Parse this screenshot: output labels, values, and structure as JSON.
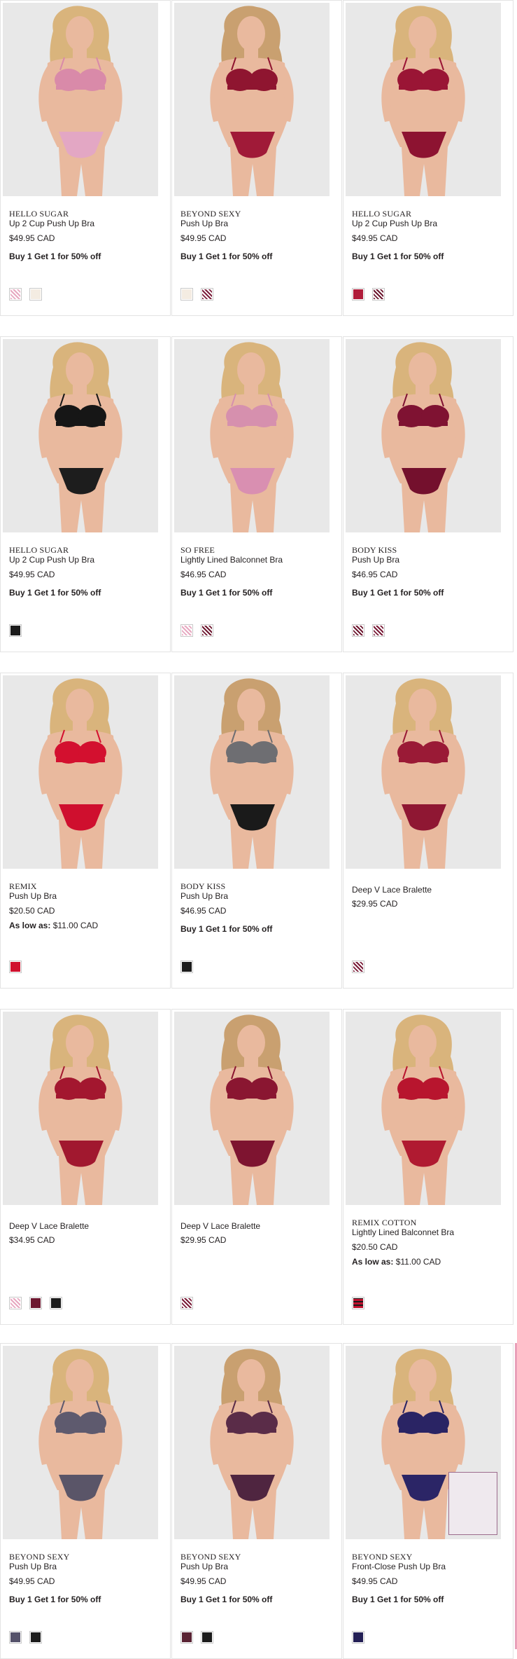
{
  "accent_colors": {
    "photo_background": "#e8e8e8",
    "card_border": "#e3e3e3",
    "text": "#231f20",
    "edge_highlight": "#e9a0b9"
  },
  "products": [
    {
      "brand": "HELLO SUGAR",
      "name": "Up 2 Cup Push Up Bra",
      "price": "$49.95 CAD",
      "promo": "Buy 1 Get 1 for 50% off",
      "swatches": [
        {
          "name": "pink-lace-swatch",
          "color": "#e7a8c0",
          "pattern": "lace"
        },
        {
          "name": "ivory-swatch",
          "color": "#f4ece2",
          "pattern": "solid"
        }
      ],
      "model": {
        "bra": "#d98aa9",
        "panty": "#e3a7c4",
        "skin": "#e9b99e",
        "hair": "#d9b47c"
      }
    },
    {
      "brand": "BEYOND SEXY",
      "name": "Push Up Bra",
      "price": "$49.95 CAD",
      "promo": "Buy 1 Get 1 for 50% off",
      "swatches": [
        {
          "name": "ivory-swatch",
          "color": "#f4ece2",
          "pattern": "solid"
        },
        {
          "name": "wine-swatch",
          "color": "#7c1f3c",
          "pattern": "lace"
        }
      ],
      "model": {
        "bra": "#8f1530",
        "panty": "#a01a38",
        "skin": "#e9b99e",
        "hair": "#c9a070"
      }
    },
    {
      "brand": "HELLO SUGAR",
      "name": "Up 2 Cup Push Up Bra",
      "price": "$49.95 CAD",
      "promo": "Buy 1 Get 1 for 50% off",
      "swatches": [
        {
          "name": "red-swatch",
          "color": "#b01c3a",
          "pattern": "solid"
        },
        {
          "name": "wine-swatch",
          "color": "#6d1830",
          "pattern": "lace"
        }
      ],
      "model": {
        "bra": "#9a1535",
        "panty": "#8d1331",
        "skin": "#e9b99e",
        "hair": "#d9b47c"
      }
    },
    {
      "brand": "HELLO SUGAR",
      "name": "Up 2 Cup Push Up Bra",
      "price": "$49.95 CAD",
      "promo": "Buy 1 Get 1 for 50% off",
      "swatches": [
        {
          "name": "black-swatch",
          "color": "#1c1c1c",
          "pattern": "solid"
        }
      ],
      "model": {
        "bra": "#161616",
        "panty": "#1d1d1d",
        "skin": "#e9b99e",
        "hair": "#d9b47c"
      }
    },
    {
      "brand": "SO FREE",
      "name": "Lightly Lined Balconnet Bra",
      "price": "$46.95 CAD",
      "promo": "Buy 1 Get 1 for 50% off",
      "swatches": [
        {
          "name": "pink-lace-swatch",
          "color": "#e7a8c0",
          "pattern": "lace"
        },
        {
          "name": "wine-swatch",
          "color": "#6d1830",
          "pattern": "lace"
        }
      ],
      "model": {
        "bra": "#d690ae",
        "panty": "#d98fb1",
        "skin": "#e9b99e",
        "hair": "#d9b47c"
      }
    },
    {
      "brand": "BODY KISS",
      "name": "Push Up Bra",
      "price": "$46.95 CAD",
      "promo": "Buy 1 Get 1 for 50% off",
      "swatches": [
        {
          "name": "wine-swatch",
          "color": "#6d1830",
          "pattern": "lace"
        },
        {
          "name": "wine-swatch",
          "color": "#7a1c38",
          "pattern": "lace"
        }
      ],
      "model": {
        "bra": "#7f1232",
        "panty": "#74102d",
        "skin": "#e9b99e",
        "hair": "#d9b47c"
      }
    },
    {
      "brand": "REMIX",
      "name": "Push Up Bra",
      "price": "$20.50 CAD",
      "promo": "As low as:",
      "promo_value": "$11.00 CAD",
      "swatches": [
        {
          "name": "red-swatch",
          "color": "#d0102e",
          "pattern": "solid"
        }
      ],
      "model": {
        "bra": "#d3102f",
        "panty": "#cf0f2e",
        "skin": "#e9b99e",
        "hair": "#d9b47c"
      }
    },
    {
      "brand": "BODY KISS",
      "name": "Push Up Bra",
      "price": "$46.95 CAD",
      "promo": "Buy 1 Get 1 for 50% off",
      "swatches": [
        {
          "name": "black-swatch",
          "color": "#1c1c1c",
          "pattern": "solid"
        }
      ],
      "model": {
        "bra": "#6e6e72",
        "panty": "#1a1a1a",
        "skin": "#e9b99e",
        "hair": "#c9a070"
      }
    },
    {
      "brand": "",
      "name": "Deep V Lace Bralette",
      "price": "$29.95 CAD",
      "promo": "",
      "swatches": [
        {
          "name": "wine-swatch",
          "color": "#7a1c38",
          "pattern": "lace"
        }
      ],
      "model": {
        "bra": "#9a1a36",
        "panty": "#8f1733",
        "skin": "#e9b99e",
        "hair": "#d9b47c"
      }
    },
    {
      "brand": "",
      "name": "Deep V Lace Bralette",
      "price": "$34.95 CAD",
      "promo": "",
      "swatches": [
        {
          "name": "pink-lace-swatch",
          "color": "#e7a8c0",
          "pattern": "lace"
        },
        {
          "name": "wine-swatch",
          "color": "#6d1830",
          "pattern": "solid"
        },
        {
          "name": "black-swatch",
          "color": "#1c1c1c",
          "pattern": "solid"
        }
      ],
      "model": {
        "bra": "#a3172f",
        "panty": "#a1182f",
        "skin": "#e9b99e",
        "hair": "#d9b47c"
      }
    },
    {
      "brand": "",
      "name": "Deep V Lace Bralette",
      "price": "$29.95 CAD",
      "promo": "",
      "swatches": [
        {
          "name": "wine-swatch",
          "color": "#7a1c38",
          "pattern": "lace"
        }
      ],
      "model": {
        "bra": "#8a1631",
        "panty": "#7e1430",
        "skin": "#e9b99e",
        "hair": "#c9a070"
      }
    },
    {
      "brand": "REMIX COTTON",
      "name": "Lightly Lined Balconnet Bra",
      "price": "$20.50 CAD",
      "promo": "As low as:",
      "promo_value": "$11.00 CAD",
      "swatches": [
        {
          "name": "red-plaid-swatch",
          "color": "#c1122f",
          "pattern": "plaid"
        }
      ],
      "model": {
        "bra": "#b8152e",
        "panty": "#b01a31",
        "skin": "#e9b99e",
        "hair": "#d9b47c"
      }
    },
    {
      "brand": "BEYOND SEXY",
      "name": "Push Up Bra",
      "price": "$49.95 CAD",
      "promo": "Buy 1 Get 1 for 50% off",
      "swatches": [
        {
          "name": "slate-swatch",
          "color": "#55526a",
          "pattern": "solid"
        },
        {
          "name": "black-swatch",
          "color": "#1c1c1c",
          "pattern": "solid"
        }
      ],
      "model": {
        "bra": "#5e5a6e",
        "panty": "#5a5568",
        "skin": "#e9b99e",
        "hair": "#d9b47c"
      }
    },
    {
      "brand": "BEYOND SEXY",
      "name": "Push Up Bra",
      "price": "$49.95 CAD",
      "promo": "Buy 1 Get 1 for 50% off",
      "swatches": [
        {
          "name": "plum-swatch",
          "color": "#5a2434",
          "pattern": "solid"
        },
        {
          "name": "black-swatch",
          "color": "#1c1c1c",
          "pattern": "solid"
        }
      ],
      "model": {
        "bra": "#5a2c48",
        "panty": "#4f2540",
        "skin": "#e9b99e",
        "hair": "#c9a070"
      }
    },
    {
      "brand": "BEYOND SEXY",
      "name": "Front-Close Push Up Bra",
      "price": "$49.95 CAD",
      "promo": "Buy 1 Get 1 for 50% off",
      "swatches": [
        {
          "name": "navy-swatch",
          "color": "#231f55",
          "pattern": "solid"
        }
      ],
      "model": {
        "bra": "#2a2464",
        "panty": "#2b2566",
        "skin": "#e9b99e",
        "hair": "#d9b47c"
      }
    }
  ]
}
